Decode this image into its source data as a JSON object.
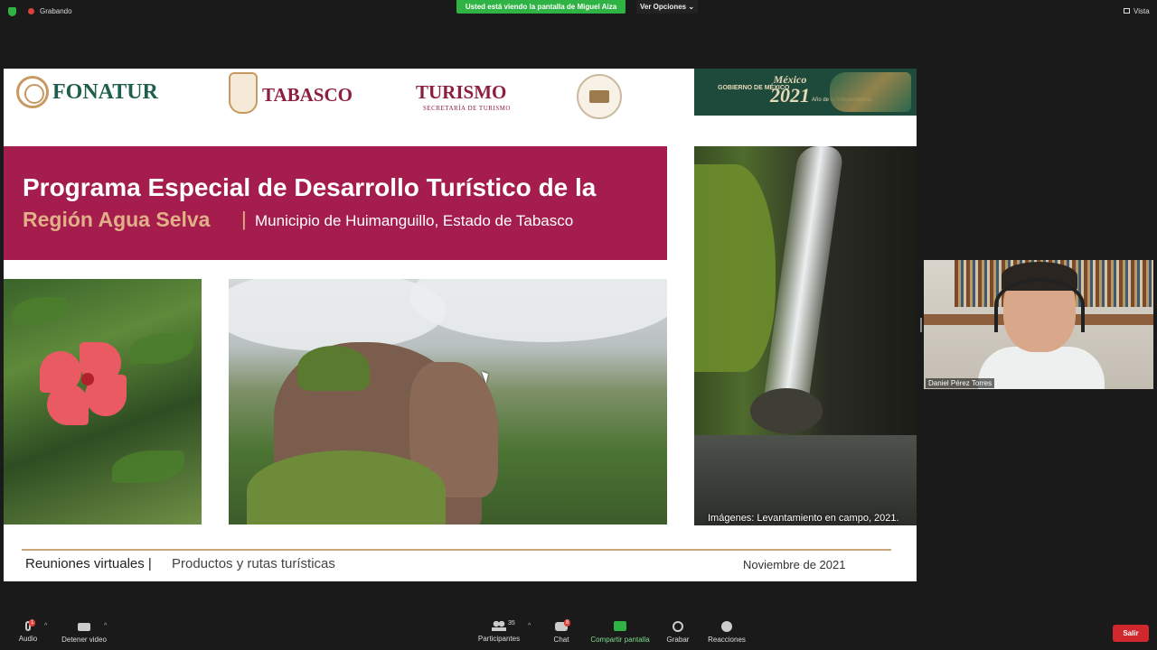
{
  "topbar": {
    "recording_label": "Grabando",
    "share_banner": "Usted está viendo la pantalla de Miguel Aiza",
    "view_options": "Ver Opciones ⌄",
    "view_label": "Vista"
  },
  "slide": {
    "logos": {
      "fonatur": "FONATUR",
      "tabasco": "TABASCO",
      "turismo": "TURISMO",
      "turismo_sub": "SECRETARÍA DE TURISMO"
    },
    "mexico_banner": {
      "gov": "GOBIERNO DE MÉXICO",
      "mexico": "México",
      "year": "2021",
      "sub": "Año de la Independencia"
    },
    "title_line1": "Programa Especial de Desarrollo Turístico de la",
    "title_region": "Región Agua Selva",
    "title_sep": "|",
    "title_municipio": "Municipio de Huimanguillo, Estado de Tabasco",
    "photo_caption": "Imágenes: Levantamiento en campo, 2021.",
    "footer_left_a": "Reuniones virtuales |",
    "footer_left_b": "Productos y rutas turísticas",
    "footer_date": "Noviembre de 2021"
  },
  "participant": {
    "name": "Daniel Pérez Torres"
  },
  "toolbar": {
    "audio": "Audio",
    "audio_badge": "1",
    "video": "Detener video",
    "participants": "Participantes",
    "participants_count": "35",
    "chat": "Chat",
    "chat_badge": "8",
    "share": "Compartir pantalla",
    "record": "Grabar",
    "reactions": "Reacciones",
    "leave": "Salir"
  },
  "colors": {
    "accent_green": "#2fb344",
    "slide_title_bg": "#a41d4d",
    "region_text": "#e1b088",
    "leave_red": "#d1282e"
  }
}
